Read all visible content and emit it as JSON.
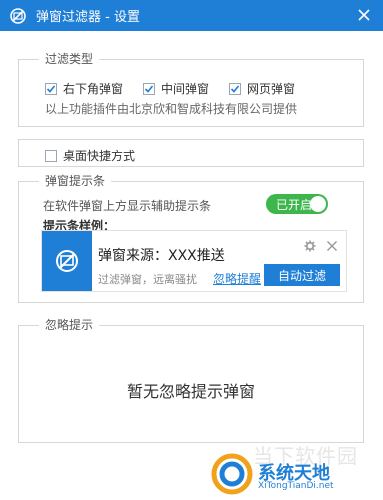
{
  "window": {
    "title": "弹窗过滤器 - 设置",
    "app_icon": "block-icon",
    "close_icon": "close-icon"
  },
  "filter_types": {
    "title": "过滤类型",
    "options": [
      {
        "label": "右下角弹窗",
        "checked": true
      },
      {
        "label": "中间弹窗",
        "checked": true
      },
      {
        "label": "网页弹窗",
        "checked": true
      }
    ],
    "provider_note": "以上功能插件由北京欣和智成科技有限公司提供"
  },
  "desktop_shortcut": {
    "label": "桌面快捷方式",
    "checked": false
  },
  "popup_hint": {
    "title": "弹窗提示条",
    "description": "在软件弹窗上方显示辅助提示条",
    "toggle_label": "已开启",
    "toggle_on": true,
    "sample_title": "提示条样例：",
    "sample": {
      "source": "弹窗来源：XXX推送",
      "desc": "过滤弹窗，远离骚扰",
      "ignore_link": "忽略提醒",
      "auto_button": "自动过滤"
    }
  },
  "ignored": {
    "title": "忽略提示",
    "empty_text": "暂无忽略提示弹窗"
  },
  "watermark": {
    "faint": "当下软件园",
    "main": "系统天地",
    "sub": "XiTongTianDi.net"
  },
  "colors": {
    "accent": "#1f7fd6",
    "toggle_on": "#3cb64d"
  }
}
